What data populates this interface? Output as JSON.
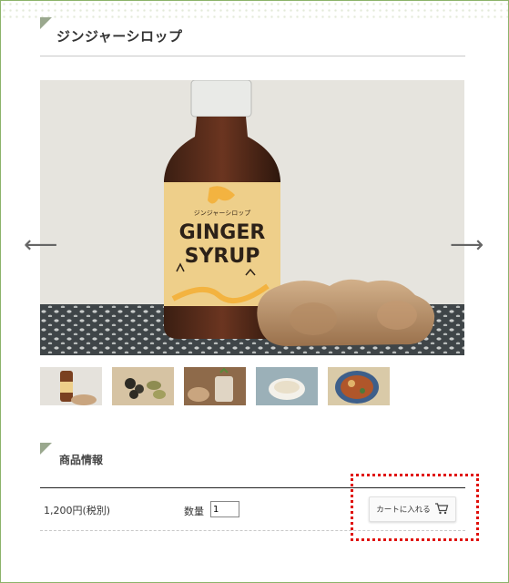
{
  "product": {
    "title": "ジンジャーシロップ"
  },
  "gallery": {
    "label_small": "ジンジャーシロップ",
    "label_line1": "GINGER",
    "label_line2": "SYRUP",
    "prev_arrow": "⟵",
    "next_arrow": "⟶",
    "thumbnail_count": 5
  },
  "info": {
    "heading": "商品情報",
    "price": "1,200円(税別)",
    "quantity_label": "数量",
    "quantity_value": "1",
    "cart_button": "カートに入れる"
  },
  "colors": {
    "accent_green": "#8cb36a",
    "highlight_red": "#e0100a"
  }
}
